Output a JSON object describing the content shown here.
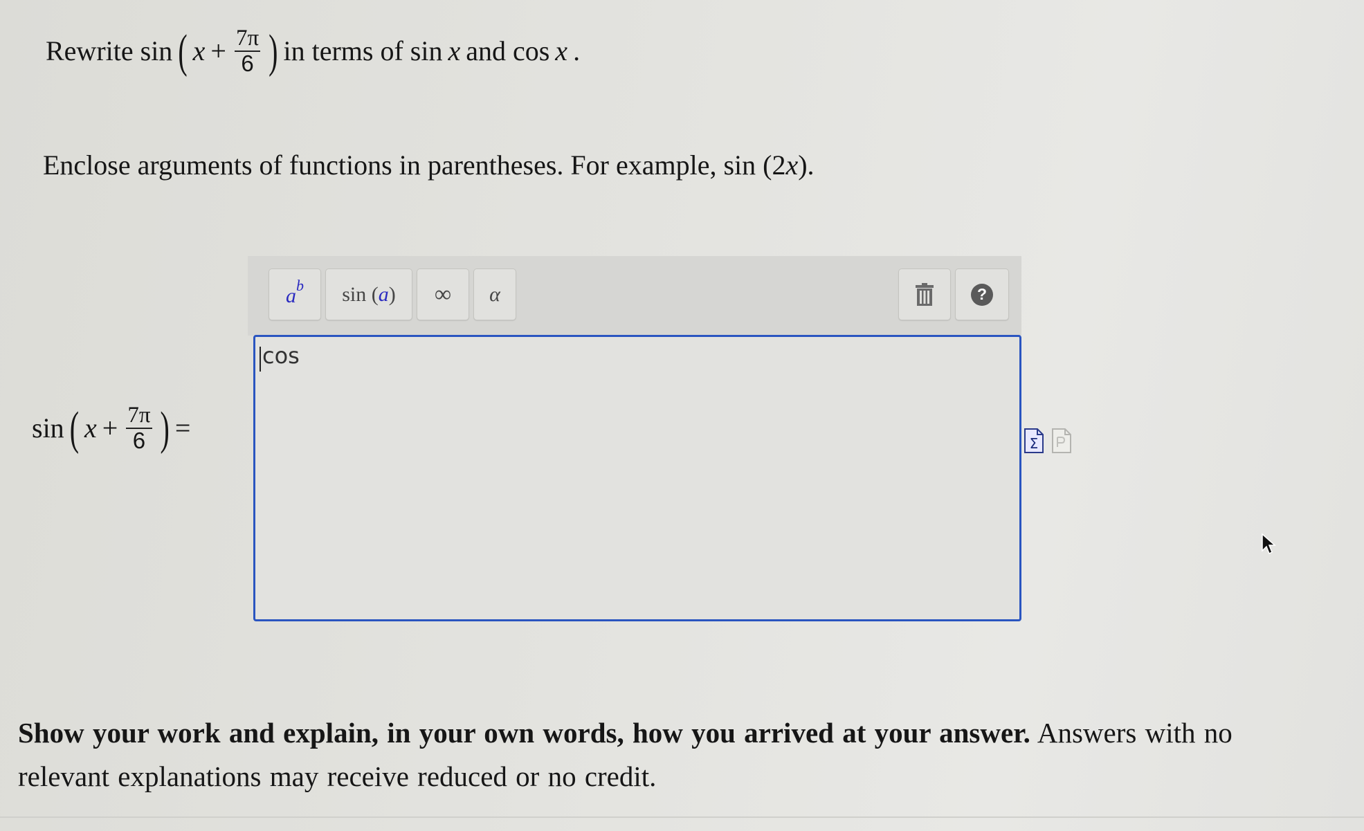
{
  "question": {
    "prefix": "Rewrite sin",
    "var": "x",
    "plus": "+",
    "frac_num": "7π",
    "frac_den": "6",
    "suffix_a": "in terms of sin",
    "suffix_var1": "x",
    "suffix_b": "and cos",
    "suffix_var2": "x",
    "suffix_end": "."
  },
  "instruction": {
    "text": "Enclose arguments of functions in parentheses. For example, sin",
    "example_arg": "(2",
    "example_var": "x",
    "example_end": ")."
  },
  "equation_lhs": {
    "func": "sin",
    "var": "x",
    "plus": "+",
    "frac_num": "7π",
    "frac_den": "6",
    "equals": "="
  },
  "toolbar": {
    "power_base": "a",
    "power_exp": "b",
    "func_name": "sin",
    "func_arg": "a",
    "infinity": "∞",
    "alpha": "α",
    "help": "?"
  },
  "answer": {
    "value": "cos"
  },
  "footer": {
    "bold_text": "Show your work and explain, in your own words, how you arrived at your answer.",
    "normal_text": " Answers with no relevant explanations may receive reduced or no credit."
  },
  "colors": {
    "accent_border": "#2a55c0",
    "toolbar_symbol": "#2b2bc0",
    "background": "#e3e3df"
  },
  "icons": [
    "power-icon",
    "trash-icon",
    "help-icon",
    "equation-editor-icon",
    "document-icon",
    "mouse-cursor-icon"
  ]
}
